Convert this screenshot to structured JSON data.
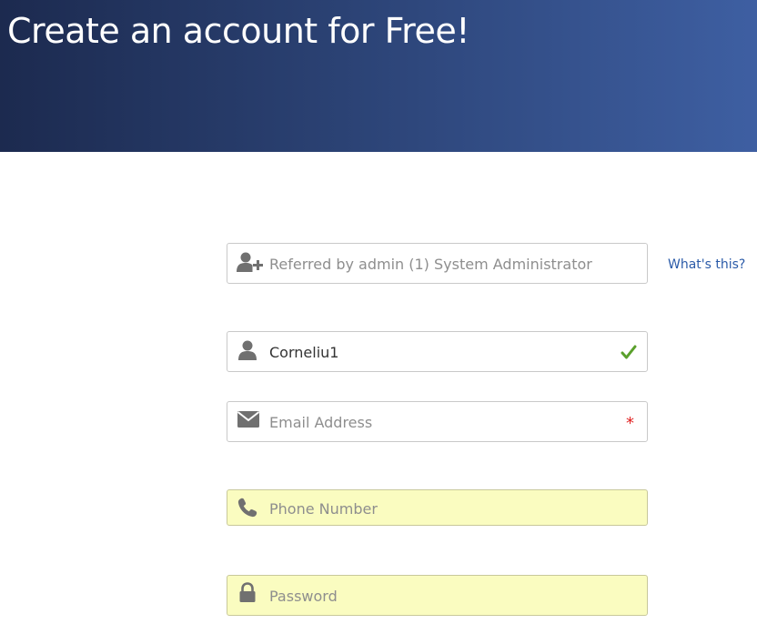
{
  "header": {
    "title": "Create an account for Free!"
  },
  "form": {
    "referral": {
      "value": "Referred by admin (1) System Administrator",
      "help_link": "What's this?"
    },
    "username": {
      "value": "Corneliu1",
      "valid": true
    },
    "email": {
      "placeholder": "Email Address",
      "required_marker": "*"
    },
    "phone": {
      "placeholder": "Phone Number"
    },
    "password": {
      "placeholder": "Password"
    }
  },
  "colors": {
    "banner_start": "#1c2a4f",
    "banner_end": "#3e5fa2",
    "highlight_field": "#fafcc0",
    "link": "#2a5aa8",
    "valid": "#5aa02c",
    "required": "#e02020",
    "icon": "#707070"
  },
  "icons": {
    "referral": "user-plus-icon",
    "username": "user-icon",
    "email": "envelope-icon",
    "phone": "phone-icon",
    "password": "lock-icon",
    "valid": "checkmark-icon"
  }
}
